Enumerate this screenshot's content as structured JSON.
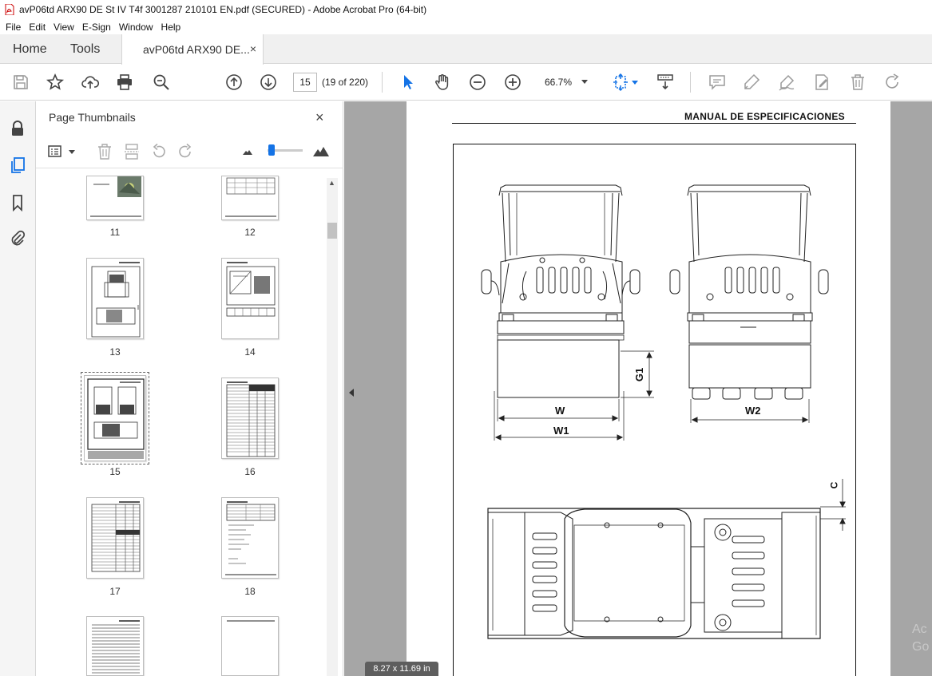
{
  "window": {
    "title": "avP06td ARX90 DE St IV T4f 3001287 210101 EN.pdf (SECURED) - Adobe Acrobat Pro (64-bit)"
  },
  "menu": {
    "items": [
      "File",
      "Edit",
      "View",
      "E-Sign",
      "Window",
      "Help"
    ]
  },
  "tabs": {
    "home": "Home",
    "tools": "Tools",
    "document": "avP06td ARX90 DE...",
    "close_glyph": "×"
  },
  "toolbar": {
    "page_number": "15",
    "page_of": "(19 of 220)",
    "zoom": "66.7%"
  },
  "thumbnails_panel": {
    "title": "Page Thumbnails",
    "close_glyph": "×",
    "scroll_up_glyph": "▲",
    "pages": [
      {
        "label": "11"
      },
      {
        "label": "12"
      },
      {
        "label": "13"
      },
      {
        "label": "14"
      },
      {
        "label": "15",
        "selected": true
      },
      {
        "label": "16"
      },
      {
        "label": "17"
      },
      {
        "label": "18"
      }
    ]
  },
  "document": {
    "header": "MANUAL DE ESPECIFICACIONES",
    "dimension_labels": {
      "w": "W",
      "w1": "W1",
      "w2": "W2",
      "g1": "G1",
      "c": "C"
    },
    "page_size": "8.27 x 11.69 in",
    "watermark_lines": [
      "Ac",
      "Go"
    ]
  }
}
